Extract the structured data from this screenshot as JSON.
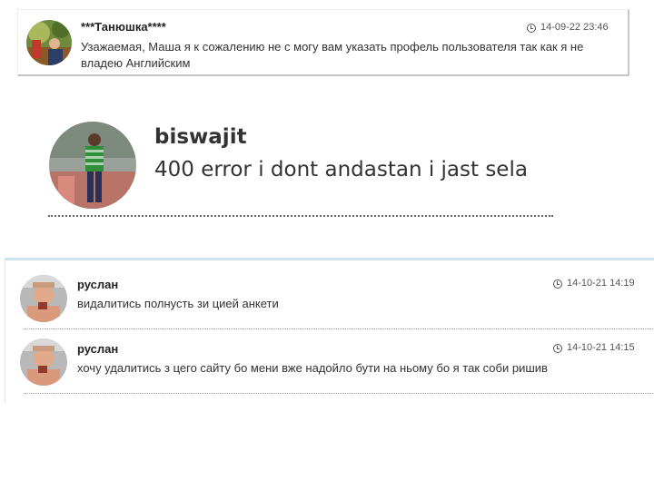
{
  "comments": [
    {
      "username": "***Танюшка****",
      "timestamp": "14-09-22 23:46",
      "message": "Узажаемая, Маша я к сожалению не с могу вам указать профель пользователя так как я не владею Английским"
    },
    {
      "username": "biswajit",
      "message": "400 error i dont andastan i jast sela"
    },
    {
      "username": "руслан",
      "timestamp": "14-10-21 14:19",
      "message": "видалитись полнусть зи цией анкети"
    },
    {
      "username": "руслан",
      "timestamp": "14-10-21 14:15",
      "message": "хочу удалитись з цего сайту бо мени вже надойло бути на ньому бо я так соби ришив"
    }
  ]
}
